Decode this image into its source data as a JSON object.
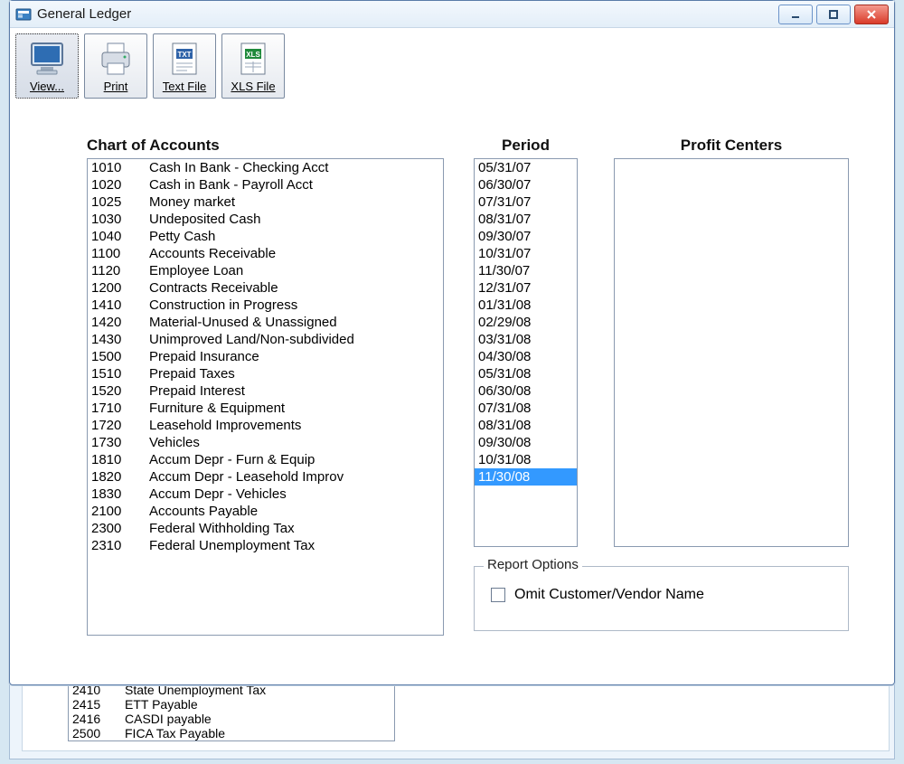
{
  "window": {
    "title": "General Ledger"
  },
  "toolbar": {
    "view": "View...",
    "print": "Print",
    "text_file": "Text File",
    "xls_file": "XLS File"
  },
  "labels": {
    "chart_of_accounts": "Chart of Accounts",
    "period": "Period",
    "profit_centers": "Profit Centers",
    "report_options": "Report Options",
    "omit_name": "Omit Customer/Vendor Name"
  },
  "accounts": [
    {
      "code": "1010",
      "name": "Cash In Bank - Checking Acct"
    },
    {
      "code": "1020",
      "name": "Cash in Bank - Payroll Acct"
    },
    {
      "code": "1025",
      "name": "Money market"
    },
    {
      "code": "1030",
      "name": "Undeposited Cash"
    },
    {
      "code": "1040",
      "name": "Petty Cash"
    },
    {
      "code": "1100",
      "name": "Accounts Receivable"
    },
    {
      "code": "1120",
      "name": "Employee Loan"
    },
    {
      "code": "1200",
      "name": "Contracts Receivable"
    },
    {
      "code": "1410",
      "name": "Construction in Progress"
    },
    {
      "code": "1420",
      "name": "Material-Unused & Unassigned"
    },
    {
      "code": "1430",
      "name": "Unimproved Land/Non-subdivided"
    },
    {
      "code": "1500",
      "name": "Prepaid Insurance"
    },
    {
      "code": "1510",
      "name": "Prepaid Taxes"
    },
    {
      "code": "1520",
      "name": "Prepaid Interest"
    },
    {
      "code": "1710",
      "name": "Furniture & Equipment"
    },
    {
      "code": "1720",
      "name": "Leasehold Improvements"
    },
    {
      "code": "1730",
      "name": "Vehicles"
    },
    {
      "code": "1810",
      "name": "Accum Depr - Furn & Equip"
    },
    {
      "code": "1820",
      "name": "Accum Depr - Leasehold Improv"
    },
    {
      "code": "1830",
      "name": "Accum Depr - Vehicles"
    },
    {
      "code": "2100",
      "name": "Accounts Payable"
    },
    {
      "code": "2300",
      "name": "Federal Withholding Tax"
    },
    {
      "code": "2310",
      "name": "Federal Unemployment Tax"
    }
  ],
  "periods": [
    "05/31/07",
    "06/30/07",
    "07/31/07",
    "08/31/07",
    "09/30/07",
    "10/31/07",
    "11/30/07",
    "12/31/07",
    "01/31/08",
    "02/29/08",
    "03/31/08",
    "04/30/08",
    "05/31/08",
    "06/30/08",
    "07/31/08",
    "08/31/08",
    "09/30/08",
    "10/31/08",
    "11/30/08"
  ],
  "selected_period": "11/30/08",
  "behind_accounts": [
    {
      "code": "2410",
      "name": "State Unemployment Tax"
    },
    {
      "code": "2415",
      "name": "ETT Payable"
    },
    {
      "code": "2416",
      "name": "CASDI payable"
    },
    {
      "code": "2500",
      "name": "FICA Tax Payable"
    }
  ]
}
